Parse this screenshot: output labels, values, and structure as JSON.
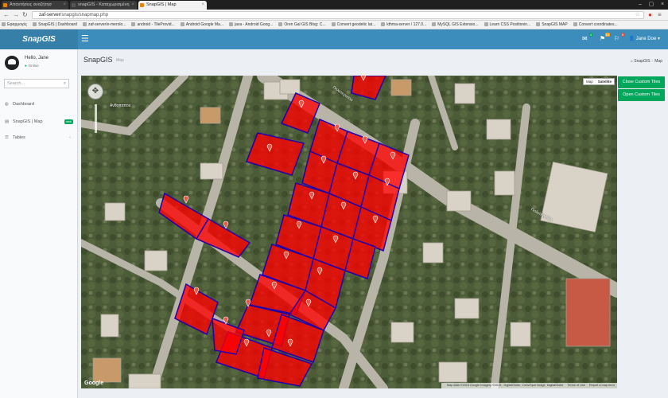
{
  "browser": {
    "tabs": [
      {
        "label": "Απαντήσεις αναζήτησ",
        "active": false
      },
      {
        "label": "snapGIS - Καταχωρισμένη",
        "active": false
      },
      {
        "label": "SnapGIS | Map",
        "active": true
      }
    ],
    "address_host": "zaf-server",
    "address_path": "/snapgis/snapmap.php",
    "bookmarks": [
      "Εφαρμογές",
      "SnapGIS | Dashboard",
      "zaf-server/e-merolo...",
      "android - TileProvid...",
      "Android Google Ma...",
      "java - Android Goog...",
      "Oren Gal GIS Blog: C...",
      "Convert geodetic lat...",
      "kthma-server / 127.0...",
      "MySQL GIS Extensio...",
      "Learn CSS Positionin...",
      "SnapGIS MAP",
      "Convert coordinates..."
    ]
  },
  "app": {
    "logo": "SnapGIS",
    "menu_icon": "☰",
    "notifications": [
      {
        "icon": "envelope-icon",
        "glyph": "✉",
        "count": "4",
        "color": "#00a65a"
      },
      {
        "icon": "bell-icon",
        "glyph": "⚑",
        "count": "10",
        "color": "#f39c12"
      },
      {
        "icon": "flag-icon",
        "glyph": "⚐",
        "count": "9",
        "color": "#dd4b39"
      }
    ],
    "user_name": "Jane Doe"
  },
  "sidebar": {
    "greeting": "Hello, Jane",
    "status": "Online",
    "search_placeholder": "Search...",
    "items": [
      {
        "label": "Dashboard",
        "icon": "dashboard-icon",
        "glyph": "◍"
      },
      {
        "label": "SnapGIS | Map",
        "icon": "map-icon",
        "glyph": "▤",
        "badge": "new"
      },
      {
        "label": "Tables",
        "icon": "table-icon",
        "glyph": "☰",
        "chevron": "‹"
      }
    ]
  },
  "header": {
    "title": "SnapGIS",
    "subtitle": "Map",
    "breadcrumb_home": "SnapGIS",
    "breadcrumb_current": "Map"
  },
  "map": {
    "type_options": [
      "Map",
      "Satellite"
    ],
    "selected_type": "Satellite",
    "logo": "Google",
    "attribution": "Map data ©2015 Google Imagery ©2015 , DigitalGlobe, Cnes/Spot Image, DigitalGlobe",
    "terms": "Terms of Use",
    "report": "Report a map error",
    "street_labels": [
      "Πολυτεχνείου",
      "Ανθοπαπου"
    ],
    "parcel_color": "#ff0000",
    "parcel_border": "#2200aa"
  },
  "actions": {
    "close_tiles": "Close Custom Tiles",
    "open_tiles": "Open Custom Tiles"
  }
}
